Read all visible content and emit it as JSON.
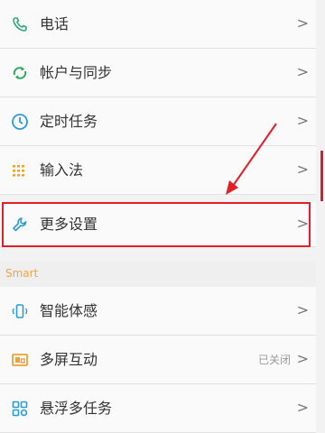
{
  "items": [
    {
      "label": "电话",
      "icon": "phone-icon",
      "color": "#2ea77a"
    },
    {
      "label": "帐户与同步",
      "icon": "sync-icon",
      "color": "#33a65f"
    },
    {
      "label": "定时任务",
      "icon": "clock-icon",
      "color": "#2b9bd6"
    },
    {
      "label": "输入法",
      "icon": "keyboard-icon",
      "color": "#f2a12f"
    },
    {
      "label": "更多设置",
      "icon": "wrench-icon",
      "color": "#2b9bd6"
    },
    {
      "label": "智能体感",
      "icon": "motion-icon",
      "color": "#2b9bd6"
    },
    {
      "label": "多屏互动",
      "icon": "multiscreen-icon",
      "color": "#f2a12f"
    },
    {
      "label": "悬浮多任务",
      "icon": "floating-task-icon",
      "color": "#2b9bd6"
    }
  ],
  "section_title": "Smart",
  "status_multiscreen": "已关闭",
  "chevron": ">",
  "accent_red": "#e21f26"
}
